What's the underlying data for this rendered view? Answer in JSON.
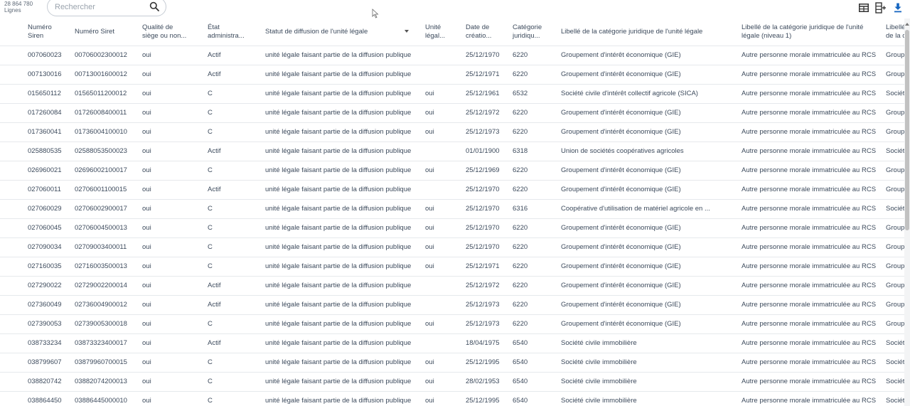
{
  "header": {
    "row_count": "28 864 780",
    "row_count_unit": "Lignes",
    "search_placeholder": "Rechercher"
  },
  "icons": {
    "search": "search-icon",
    "table_view": "table-view-icon",
    "add_column": "add-column-icon",
    "download": "download-icon",
    "accent": "#1565c0"
  },
  "columns": [
    [
      "Numéro",
      "Siren"
    ],
    [
      "Numéro Siret"
    ],
    [
      "Qualité de",
      "siège ou non..."
    ],
    [
      "État",
      "administra..."
    ],
    [
      "Statut de diffusion de l'unité légale"
    ],
    [
      "Unité",
      "légal..."
    ],
    [
      "Date de",
      "créatio..."
    ],
    [
      "Catégorie",
      "juridiqu..."
    ],
    [
      "Libellé de la catégorie juridique de l'unité légale"
    ],
    [
      "Libellé de la catégorie juridique de l'unité",
      "légale (niveau 1)"
    ],
    [
      "Libellé",
      "de la c"
    ]
  ],
  "rows": [
    [
      "007060023",
      "00706002300012",
      "oui",
      "Actif",
      "unité légale faisant partie de la diffusion publique",
      "",
      "25/12/1970",
      "6220",
      "Groupement d'intérêt économique (GIE)",
      "Autre personne morale immatriculée au RCS",
      "Group"
    ],
    [
      "007130016",
      "00713001600012",
      "oui",
      "Actif",
      "unité légale faisant partie de la diffusion publique",
      "",
      "25/12/1971",
      "6220",
      "Groupement d'intérêt économique (GIE)",
      "Autre personne morale immatriculée au RCS",
      "Group"
    ],
    [
      "015650112",
      "01565011200012",
      "oui",
      "C",
      "unité légale faisant partie de la diffusion publique",
      "oui",
      "25/12/1961",
      "6532",
      "Société civile d'intérêt collectif agricole (SICA)",
      "Autre personne morale immatriculée au RCS",
      "Sociét"
    ],
    [
      "017260084",
      "01726008400011",
      "oui",
      "C",
      "unité légale faisant partie de la diffusion publique",
      "oui",
      "25/12/1972",
      "6220",
      "Groupement d'intérêt économique (GIE)",
      "Autre personne morale immatriculée au RCS",
      "Group"
    ],
    [
      "017360041",
      "01736004100010",
      "oui",
      "C",
      "unité légale faisant partie de la diffusion publique",
      "oui",
      "25/12/1973",
      "6220",
      "Groupement d'intérêt économique (GIE)",
      "Autre personne morale immatriculée au RCS",
      "Group"
    ],
    [
      "025880535",
      "02588053500023",
      "oui",
      "Actif",
      "unité légale faisant partie de la diffusion publique",
      "",
      "01/01/1900",
      "6318",
      "Union de sociétés coopératives agricoles",
      "Autre personne morale immatriculée au RCS",
      "Sociét"
    ],
    [
      "026960021",
      "02696002100017",
      "oui",
      "C",
      "unité légale faisant partie de la diffusion publique",
      "oui",
      "25/12/1969",
      "6220",
      "Groupement d'intérêt économique (GIE)",
      "Autre personne morale immatriculée au RCS",
      "Group"
    ],
    [
      "027060011",
      "02706001100015",
      "oui",
      "Actif",
      "unité légale faisant partie de la diffusion publique",
      "",
      "25/12/1970",
      "6220",
      "Groupement d'intérêt économique (GIE)",
      "Autre personne morale immatriculée au RCS",
      "Group"
    ],
    [
      "027060029",
      "02706002900017",
      "oui",
      "C",
      "unité légale faisant partie de la diffusion publique",
      "oui",
      "25/12/1970",
      "6316",
      "Coopérative d'utilisation de matériel agricole en ...",
      "Autre personne morale immatriculée au RCS",
      "Sociét"
    ],
    [
      "027060045",
      "02706004500013",
      "oui",
      "C",
      "unité légale faisant partie de la diffusion publique",
      "oui",
      "25/12/1970",
      "6220",
      "Groupement d'intérêt économique (GIE)",
      "Autre personne morale immatriculée au RCS",
      "Group"
    ],
    [
      "027090034",
      "02709003400011",
      "oui",
      "C",
      "unité légale faisant partie de la diffusion publique",
      "oui",
      "25/12/1970",
      "6220",
      "Groupement d'intérêt économique (GIE)",
      "Autre personne morale immatriculée au RCS",
      "Group"
    ],
    [
      "027160035",
      "02716003500013",
      "oui",
      "C",
      "unité légale faisant partie de la diffusion publique",
      "oui",
      "25/12/1971",
      "6220",
      "Groupement d'intérêt économique (GIE)",
      "Autre personne morale immatriculée au RCS",
      "Group"
    ],
    [
      "027290022",
      "02729002200014",
      "oui",
      "Actif",
      "unité légale faisant partie de la diffusion publique",
      "",
      "25/12/1972",
      "6220",
      "Groupement d'intérêt économique (GIE)",
      "Autre personne morale immatriculée au RCS",
      "Group"
    ],
    [
      "027360049",
      "02736004900012",
      "oui",
      "Actif",
      "unité légale faisant partie de la diffusion publique",
      "",
      "25/12/1973",
      "6220",
      "Groupement d'intérêt économique (GIE)",
      "Autre personne morale immatriculée au RCS",
      "Group"
    ],
    [
      "027390053",
      "02739005300018",
      "oui",
      "C",
      "unité légale faisant partie de la diffusion publique",
      "oui",
      "25/12/1973",
      "6220",
      "Groupement d'intérêt économique (GIE)",
      "Autre personne morale immatriculée au RCS",
      "Group"
    ],
    [
      "038733234",
      "03873323400017",
      "oui",
      "Actif",
      "unité légale faisant partie de la diffusion publique",
      "",
      "18/04/1975",
      "6540",
      "Société civile immobilière",
      "Autre personne morale immatriculée au RCS",
      "Sociét"
    ],
    [
      "038799607",
      "03879960700015",
      "oui",
      "C",
      "unité légale faisant partie de la diffusion publique",
      "oui",
      "25/12/1995",
      "6540",
      "Société civile immobilière",
      "Autre personne morale immatriculée au RCS",
      "Sociét"
    ],
    [
      "038820742",
      "03882074200013",
      "oui",
      "C",
      "unité légale faisant partie de la diffusion publique",
      "oui",
      "28/02/1953",
      "6540",
      "Société civile immobilière",
      "Autre personne morale immatriculée au RCS",
      "Sociét"
    ],
    [
      "038864450",
      "03886445000010",
      "oui",
      "C",
      "unité légale faisant partie de la diffusion publique",
      "oui",
      "25/12/1995",
      "6540",
      "Société civile immobilière",
      "Autre personne morale immatriculée au RCS",
      "Sociét"
    ]
  ]
}
